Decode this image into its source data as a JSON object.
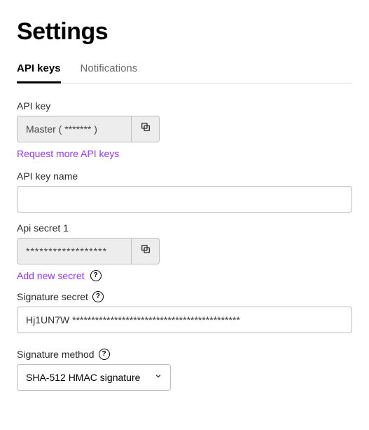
{
  "page": {
    "title": "Settings"
  },
  "tabs": {
    "api_keys": "API keys",
    "notifications": "Notifications"
  },
  "api_key_section": {
    "label": "API key",
    "value": "Master ( ******* )",
    "request_more": "Request more API keys"
  },
  "api_key_name": {
    "label": "API key name",
    "value": ""
  },
  "api_secret": {
    "label": "Api secret 1",
    "value": "******************",
    "add_new": "Add new secret"
  },
  "signature_secret": {
    "label": "Signature secret",
    "value": "Hj1UN7W ********************************************"
  },
  "signature_method": {
    "label": "Signature method",
    "selected": "SHA-512 HMAC signature"
  }
}
